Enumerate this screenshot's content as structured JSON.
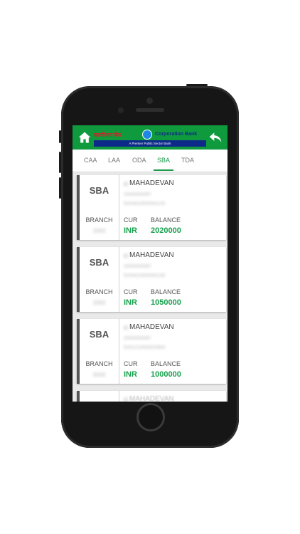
{
  "header": {
    "bank_name_hindi": "कार्पोरेशन बैंक",
    "bank_name_en": "Corporation Bank",
    "tagline": "A Premier Public Sector Bank",
    "brand_color": "#0f9b3d",
    "home_icon": "home-icon",
    "back_icon": "back-arrow-icon"
  },
  "tabs": {
    "items": [
      "CAA",
      "LAA",
      "ODA",
      "SBA",
      "TDA"
    ],
    "active": "SBA",
    "active_color": "#1a9a4a"
  },
  "accounts": [
    {
      "type": "SBA",
      "name_initial": "R",
      "name": "MAHADEVAN",
      "customer_id": "2000000087",
      "account_no": "520461000000125",
      "branch_label": "BRANCH",
      "branch_code": "3350",
      "cur_label": "CUR",
      "currency": "INR",
      "balance_label": "BALANCE",
      "balance": "2020000"
    },
    {
      "type": "SBA",
      "name_initial": "R",
      "name": "MAHADEVAN",
      "customer_id": "2000000087",
      "account_no": "520401000000100",
      "branch_label": "BRANCH",
      "branch_code": "3350",
      "cur_label": "CUR",
      "currency": "INR",
      "balance_label": "BALANCE",
      "balance": "1050000"
    },
    {
      "type": "SBA",
      "name_initial": "R",
      "name": "MAHADEVAN",
      "customer_id": "2000000087",
      "account_no": "520121000002800",
      "branch_label": "BRANCH",
      "branch_code": "0000",
      "cur_label": "CUR",
      "currency": "INR",
      "balance_label": "BALANCE",
      "balance": "1000000"
    },
    {
      "name_initial": "R",
      "name": "MAHADEVAN"
    }
  ]
}
